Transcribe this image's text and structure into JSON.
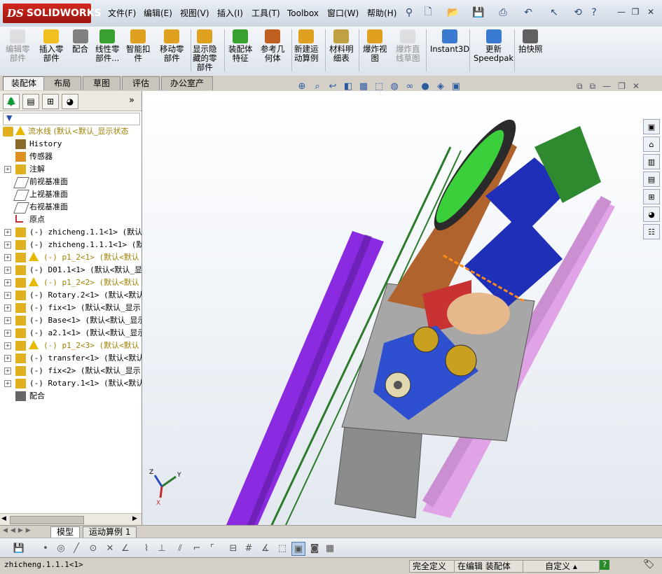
{
  "app": {
    "logo_text": "SOLIDWORKS",
    "logo_prefix": "DS"
  },
  "menu": [
    "文件(F)",
    "编辑(E)",
    "视图(V)",
    "插入(I)",
    "工具(T)",
    "Toolbox",
    "窗口(W)",
    "帮助(H)"
  ],
  "command_manager": [
    {
      "label": "编辑零\n部件",
      "enabled": false,
      "icon": "edit-component-icon"
    },
    {
      "label": "插入零\n部件",
      "enabled": true,
      "icon": "insert-component-icon"
    },
    {
      "label": "配合",
      "enabled": true,
      "icon": "mate-icon"
    },
    {
      "label": "线性零\n部件...",
      "enabled": true,
      "icon": "linear-pattern-icon"
    },
    {
      "label": "智能扣\n件",
      "enabled": true,
      "icon": "smart-fastener-icon"
    },
    {
      "label": "移动零\n部件",
      "enabled": true,
      "icon": "move-component-icon"
    },
    {
      "label": "显示隐\n藏的零\n部件",
      "enabled": true,
      "icon": "show-hidden-icon"
    },
    {
      "label": "装配体\n特征",
      "enabled": true,
      "icon": "assembly-feature-icon"
    },
    {
      "label": "参考几\n何体",
      "enabled": true,
      "icon": "reference-geometry-icon"
    },
    {
      "label": "新建运\n动算例",
      "enabled": true,
      "icon": "new-motion-study-icon"
    },
    {
      "label": "材料明\n细表",
      "enabled": true,
      "icon": "bom-icon"
    },
    {
      "label": "爆炸视\n图",
      "enabled": true,
      "icon": "exploded-view-icon"
    },
    {
      "label": "爆炸直\n线草图",
      "enabled": false,
      "icon": "explode-line-sketch-icon"
    },
    {
      "label": "Instant3D",
      "enabled": true,
      "icon": "instant3d-icon"
    },
    {
      "label": "更新\nSpeedpak",
      "enabled": true,
      "icon": "speedpak-icon"
    },
    {
      "label": "拍快照",
      "enabled": true,
      "icon": "snapshot-icon"
    }
  ],
  "tabs": [
    "装配体",
    "布局",
    "草图",
    "评估",
    "办公室产品"
  ],
  "tree": {
    "root": "流水线  (默认<默认_显示状态",
    "items": [
      {
        "text": "History",
        "type": "history",
        "expand": false,
        "warn": false
      },
      {
        "text": "传感器",
        "type": "sensor",
        "expand": false,
        "warn": false
      },
      {
        "text": "注解",
        "type": "annotation",
        "expand": true,
        "warn": false
      },
      {
        "text": "前视基准面",
        "type": "plane",
        "expand": false,
        "warn": false
      },
      {
        "text": "上视基准面",
        "type": "plane",
        "expand": false,
        "warn": false
      },
      {
        "text": "右视基准面",
        "type": "plane",
        "expand": false,
        "warn": false
      },
      {
        "text": "原点",
        "type": "origin",
        "expand": false,
        "warn": false
      },
      {
        "text": "(-) zhicheng.1.1<1> (默认<",
        "type": "part",
        "expand": true,
        "warn": false
      },
      {
        "text": "(-) zhicheng.1.1.1<1> (默认",
        "type": "part",
        "expand": true,
        "warn": false
      },
      {
        "text": "(-) p1_2<1> (默认<默认",
        "type": "part",
        "expand": true,
        "warn": true
      },
      {
        "text": "(-) D01.1<1> (默认<默认_显",
        "type": "part",
        "expand": true,
        "warn": false
      },
      {
        "text": "(-) p1_2<2> (默认<默认",
        "type": "part",
        "expand": true,
        "warn": true
      },
      {
        "text": "(-) Rotary.2<1> (默认<默认",
        "type": "part",
        "expand": true,
        "warn": false
      },
      {
        "text": "(-) fix<1> (默认<默认_显示",
        "type": "part",
        "expand": true,
        "warn": false
      },
      {
        "text": "(-) Base<1> (默认<默认_显示",
        "type": "part",
        "expand": true,
        "warn": false
      },
      {
        "text": "(-) a2.1<1> (默认<默认_显示",
        "type": "part",
        "expand": true,
        "warn": false
      },
      {
        "text": "(-) p1_2<3> (默认<默认",
        "type": "part",
        "expand": true,
        "warn": true
      },
      {
        "text": "(-) transfer<1> (默认<默认",
        "type": "part",
        "expand": true,
        "warn": false
      },
      {
        "text": "(-) fix<2> (默认<默认_显示",
        "type": "part",
        "expand": true,
        "warn": false
      },
      {
        "text": "(-) Rotary.1<1> (默认<默认",
        "type": "part",
        "expand": true,
        "warn": false
      },
      {
        "text": "配合",
        "type": "mates",
        "expand": false,
        "warn": false
      }
    ]
  },
  "bottom_tabs": [
    "模型",
    "运动算例 1"
  ],
  "status": {
    "selection": "zhicheng.1.1.1<1>",
    "definition": "完全定义",
    "mode": "在编辑 装配体",
    "units": "自定义",
    "help": "?"
  },
  "triad": {
    "x": "X",
    "y": "Y",
    "z": "Z"
  },
  "colors": {
    "purple_plate": "#8a2be2",
    "pink_plate": "#e0a3e6",
    "brown_plate": "#b0632c",
    "blue_block": "#1f2fb8",
    "green_motor": "#2f8a2f",
    "accent_orange": "#ff8c1a"
  }
}
